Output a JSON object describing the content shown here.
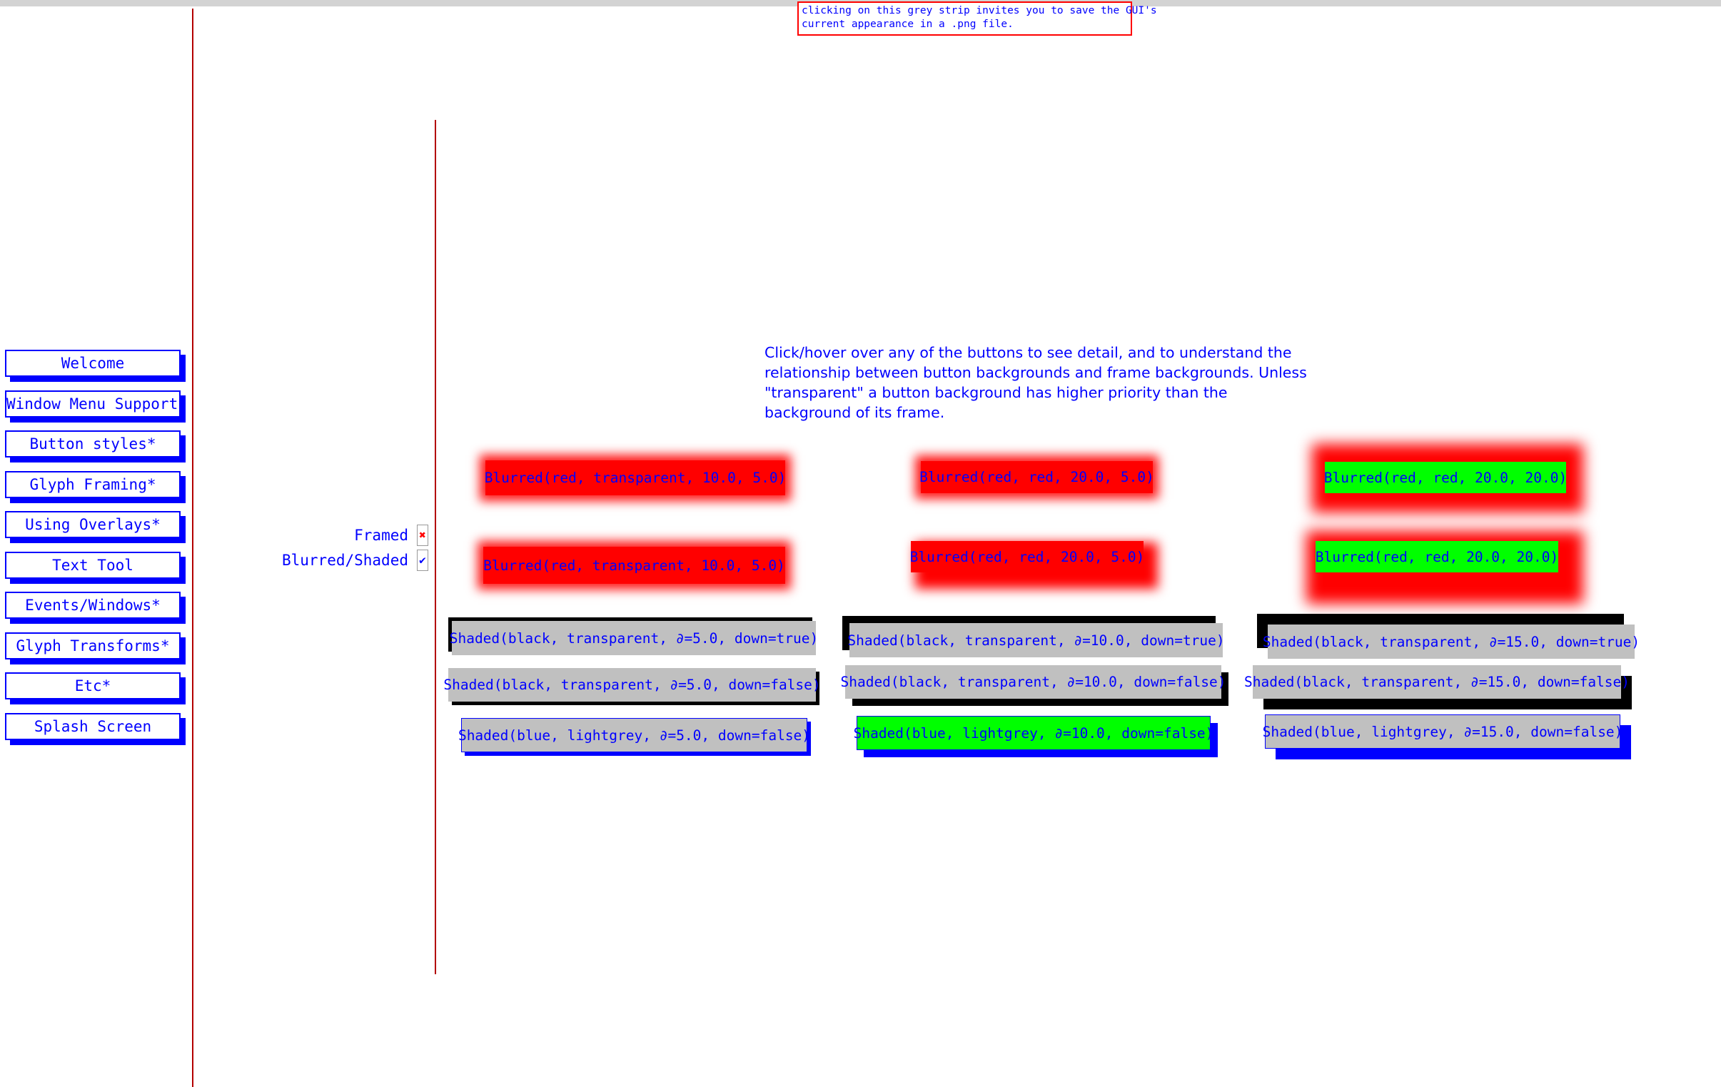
{
  "save_note": {
    "line1": "clicking on this grey strip invites you to save the GUI's",
    "line2": "current appearance in a .png file."
  },
  "menu": [
    "Welcome",
    "Window Menu Support*",
    "Button styles*",
    "Glyph Framing*",
    "Using Overlays*",
    "Text Tool",
    "Events/Windows*",
    "Glyph Transforms*",
    "Etc*",
    "Splash Screen"
  ],
  "options": {
    "framed": {
      "label": "Framed",
      "checked": false,
      "mark": "✖"
    },
    "blurred": {
      "label": "Blurred/Shaded",
      "checked": true,
      "mark": "✔"
    }
  },
  "hint": [
    "Click/hover over any of the buttons to see detail, and to understand the",
    "relationship between button backgrounds and frame backgrounds. Unless",
    "\"transparent\" a button background has higher priority than the",
    "background of its frame."
  ],
  "buttons": {
    "b1": "Blurred(red, transparent, 10.0, 5.0)",
    "b2": "Blurred(red, red, 20.0, 5.0)",
    "b3": "Blurred(red, red, 20.0, 20.0)",
    "b4": "Blurred(red, transparent, 10.0, 5.0)",
    "b5": "Blurred(red, red, 20.0, 5.0)",
    "b6": "Blurred(red, red, 20.0, 20.0)",
    "s1": "Shaded(black, transparent, ∂=5.0, down=true)",
    "s2": "Shaded(black, transparent, ∂=10.0, down=true)",
    "s3": "Shaded(black, transparent, ∂=15.0, down=true)",
    "s4": "Shaded(black, transparent, ∂=5.0, down=false)",
    "s5": "Shaded(black, transparent, ∂=10.0, down=false)",
    "s6": "Shaded(black, transparent, ∂=15.0, down=false)",
    "s7": "Shaded(blue, lightgrey, ∂=5.0, down=false)",
    "s8": "Shaded(blue, lightgrey, ∂=10.0, down=false)",
    "s9": "Shaded(blue, lightgrey, ∂=15.0, down=false)"
  },
  "colors": {
    "text": "#0000ff",
    "divider": "#b30000",
    "red": "#ff0000",
    "green": "#00ff00",
    "lightgrey": "#c0c0c0",
    "strip": "#d3d3d3"
  }
}
